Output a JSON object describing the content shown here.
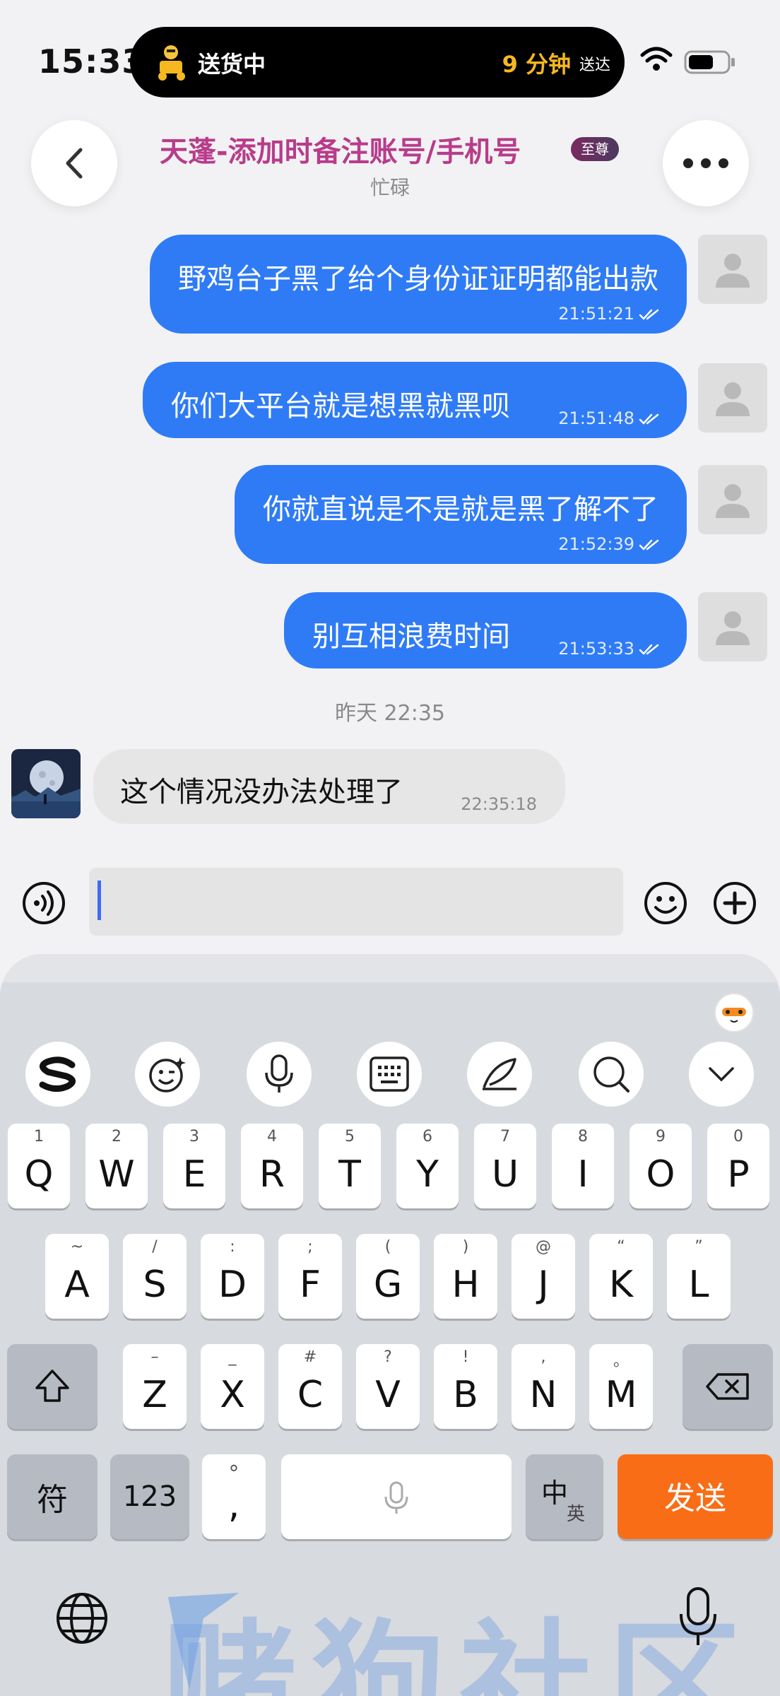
{
  "status_bar": {
    "time": "15:33",
    "live_activity": {
      "label": "送货中",
      "eta": "9 分钟",
      "eta_suffix": "送达"
    }
  },
  "header": {
    "title": "天蓬-添加时备注账号/手机号",
    "badge": "至尊",
    "status": "忙碌"
  },
  "messages": [
    {
      "direction": "out",
      "text": "野鸡台子黑了给个身份证证明都能出款",
      "time": "21:51:21",
      "read": true
    },
    {
      "direction": "out",
      "text": "你们大平台就是想黑就黑呗",
      "time": "21:51:48",
      "read": true
    },
    {
      "direction": "out",
      "text": "你就直说是不是就是黑了解不了",
      "time": "21:52:39",
      "read": true
    },
    {
      "direction": "out",
      "text": "别互相浪费时间",
      "time": "21:53:33",
      "read": true
    },
    {
      "divider": "昨天 22:35"
    },
    {
      "direction": "in",
      "text": "这个情况没办法处理了",
      "time": "22:35:18"
    }
  ],
  "input": {
    "value": "",
    "placeholder": ""
  },
  "keyboard": {
    "toolbar": [
      "sogou-logo-icon",
      "emoji-icon",
      "microphone-icon",
      "keyboard-icon",
      "pen-icon",
      "search-icon",
      "chevron-down-icon"
    ],
    "row1": [
      {
        "sub": "1",
        "main": "Q"
      },
      {
        "sub": "2",
        "main": "W"
      },
      {
        "sub": "3",
        "main": "E"
      },
      {
        "sub": "4",
        "main": "R"
      },
      {
        "sub": "5",
        "main": "T"
      },
      {
        "sub": "6",
        "main": "Y"
      },
      {
        "sub": "7",
        "main": "U"
      },
      {
        "sub": "8",
        "main": "I"
      },
      {
        "sub": "9",
        "main": "O"
      },
      {
        "sub": "0",
        "main": "P"
      }
    ],
    "row2": [
      {
        "sub": "~",
        "main": "A"
      },
      {
        "sub": "/",
        "main": "S"
      },
      {
        "sub": ":",
        "main": "D"
      },
      {
        "sub": ";",
        "main": "F"
      },
      {
        "sub": "(",
        "main": "G"
      },
      {
        "sub": ")",
        "main": "H"
      },
      {
        "sub": "@",
        "main": "J"
      },
      {
        "sub": "“",
        "main": "K"
      },
      {
        "sub": "”",
        "main": "L"
      }
    ],
    "row3": [
      {
        "sub": "–",
        "main": "Z"
      },
      {
        "sub": "_",
        "main": "X"
      },
      {
        "sub": "#",
        "main": "C"
      },
      {
        "sub": "?",
        "main": "V"
      },
      {
        "sub": "!",
        "main": "B"
      },
      {
        "sub": ",",
        "main": "N"
      },
      {
        "sub": "。",
        "main": "M"
      }
    ],
    "symbols_label": "符",
    "numbers_label": "123",
    "punct_top": "°",
    "punct_main": ",",
    "lang_main": "中",
    "lang_sub": "英",
    "send_label": "发送"
  },
  "watermark": "赌狗社区",
  "colors": {
    "bubble_out": "#2f7bf6",
    "title": "#b83c8a",
    "send_key": "#f96d16",
    "eta": "#f6b81f"
  }
}
